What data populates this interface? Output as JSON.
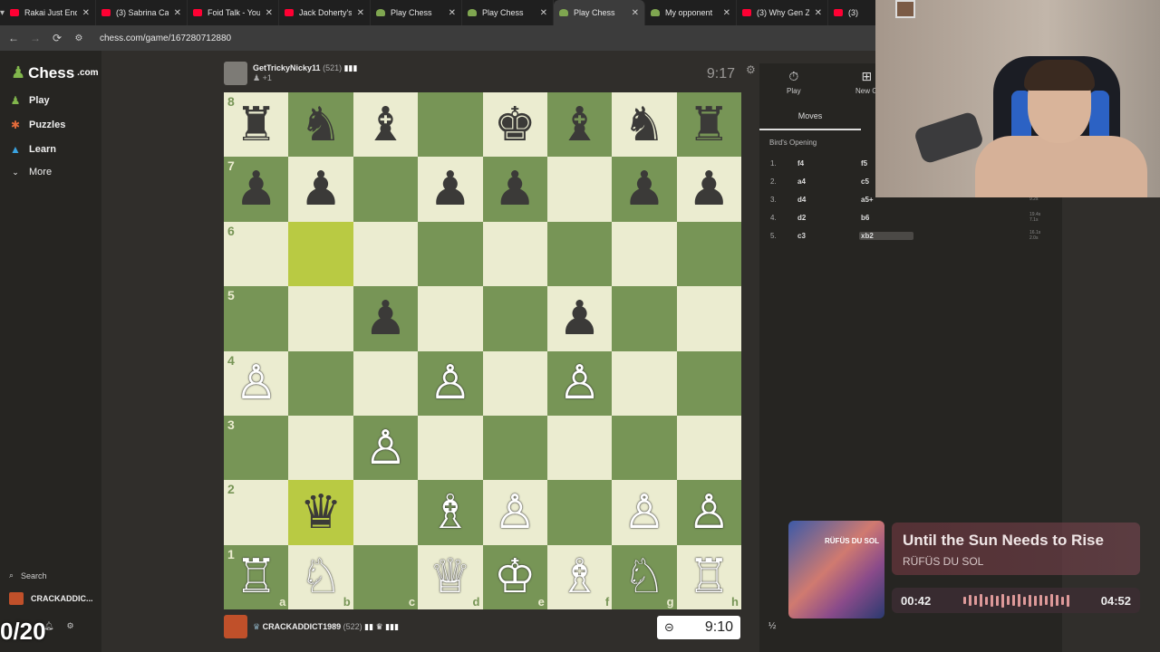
{
  "tabs": [
    {
      "title": "Rakai Just Ende",
      "icon": "youtube-icon",
      "active": false
    },
    {
      "title": "(3) Sabrina Car",
      "icon": "youtube-icon",
      "active": false
    },
    {
      "title": "Foid Talk - You",
      "icon": "youtube-icon",
      "active": false
    },
    {
      "title": "Jack Doherty's",
      "icon": "youtube-icon",
      "active": false
    },
    {
      "title": "Play Chess",
      "icon": "chess-icon",
      "active": false
    },
    {
      "title": "Play Chess",
      "icon": "chess-icon",
      "active": false
    },
    {
      "title": "Play Chess",
      "icon": "chess-icon",
      "active": true
    },
    {
      "title": "My opponent",
      "icon": "chess-icon",
      "active": false
    },
    {
      "title": "(3) Why Gen Z",
      "icon": "youtube-icon",
      "active": false
    },
    {
      "title": "(3)",
      "icon": "youtube-icon",
      "active": false
    }
  ],
  "address": {
    "url": "chess.com/game/167280712880"
  },
  "sidebar": {
    "logo": "Chess",
    "logo_suffix": ".com",
    "items": [
      {
        "label": "Play",
        "icon": "pawn-icon"
      },
      {
        "label": "Puzzles",
        "icon": "puzzle-icon"
      },
      {
        "label": "Learn",
        "icon": "learn-icon"
      },
      {
        "label": "More",
        "icon": "chevron-down-icon"
      }
    ],
    "search_label": "Search",
    "user_label": "CRACKADDIC..."
  },
  "top_player": {
    "name": "GetTrickyNicky11",
    "rating": "(521)",
    "points": "+1"
  },
  "bottom_player": {
    "name": "CRACKADDICT1989",
    "rating": "(522)"
  },
  "clocks": {
    "top": "9:17",
    "bottom": "9:10"
  },
  "board": {
    "ranks": [
      "8",
      "7",
      "6",
      "5",
      "4",
      "3",
      "2",
      "1"
    ],
    "files": [
      "a",
      "b",
      "c",
      "d",
      "e",
      "f",
      "g",
      "h"
    ],
    "position": [
      [
        "bR",
        "bN",
        "bB",
        "",
        "bK",
        "bB",
        "bN",
        "bR"
      ],
      [
        "bP",
        "bP",
        "",
        "bP",
        "bP",
        "",
        "bP",
        "bP"
      ],
      [
        "",
        "",
        "",
        "",
        "",
        "",
        "",
        ""
      ],
      [
        "",
        "",
        "bP",
        "",
        "",
        "bP",
        "",
        ""
      ],
      [
        "wP",
        "",
        "",
        "wP",
        "",
        "wP",
        "",
        ""
      ],
      [
        "",
        "",
        "wP",
        "",
        "",
        "",
        "",
        ""
      ],
      [
        "",
        "bQ",
        "",
        "wB",
        "wP",
        "",
        "wP",
        "wP"
      ],
      [
        "wR",
        "wN",
        "",
        "wQ",
        "wK",
        "wB",
        "wN",
        "wR"
      ]
    ],
    "highlight": [
      "b6",
      "b2"
    ]
  },
  "panel": {
    "play_label": "Play",
    "new_label": "New G",
    "moves_tab": "Moves",
    "opening": "Bird's Opening",
    "moves": [
      {
        "n": "1.",
        "w": "f4",
        "b": "f5",
        "t": [
          "",
          ""
        ]
      },
      {
        "n": "2.",
        "w": "a4",
        "b": "c5",
        "t": [
          "",
          ""
        ]
      },
      {
        "n": "3.",
        "w": "d4",
        "b": "a5+",
        "t": [
          "9.2s",
          ""
        ]
      },
      {
        "n": "4.",
        "w": "d2",
        "b": "b6",
        "t": [
          "19.4s",
          "7.1s"
        ]
      },
      {
        "n": "5.",
        "w": "c3",
        "b": "xb2",
        "t": [
          "16.1s",
          "2.0s"
        ]
      }
    ]
  },
  "music": {
    "title": "Until the Sun Needs to Rise",
    "artist": "RÜFÜS DU SOL",
    "album_text": "RÜFÜS DU SOL",
    "elapsed": "00:42",
    "duration": "04:52"
  },
  "overlay": {
    "fps": "0/20",
    "fraction": "½"
  }
}
